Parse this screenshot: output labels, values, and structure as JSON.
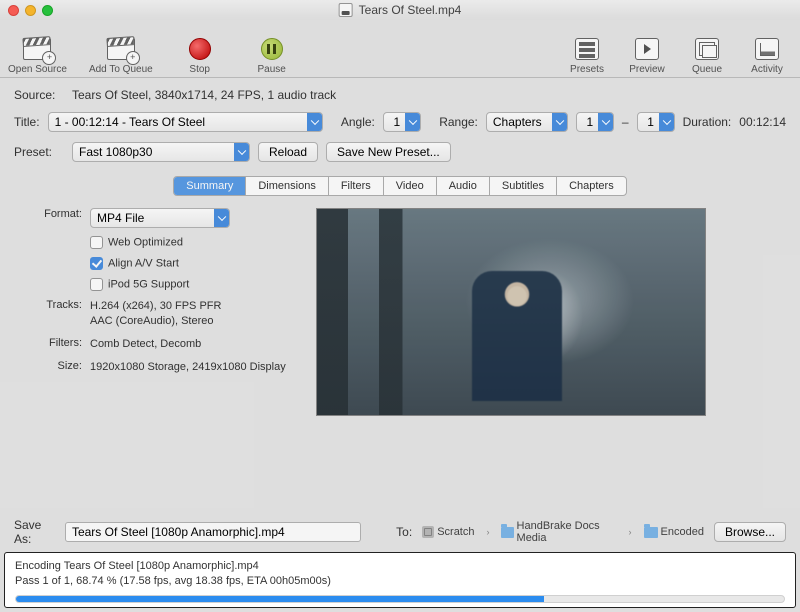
{
  "window": {
    "filename": "Tears Of Steel.mp4"
  },
  "toolbar": {
    "left": {
      "open_source": "Open Source",
      "add_to_queue": "Add To Queue",
      "stop": "Stop",
      "pause": "Pause"
    },
    "right": {
      "presets": "Presets",
      "preview": "Preview",
      "queue": "Queue",
      "activity": "Activity"
    }
  },
  "source": {
    "label": "Source:",
    "value": "Tears Of Steel, 3840x1714, 24 FPS, 1 audio track"
  },
  "title_row": {
    "label": "Title:",
    "value": "1 - 00:12:14 - Tears Of Steel",
    "angle_label": "Angle:",
    "angle_value": "1",
    "range_label": "Range:",
    "range_type": "Chapters",
    "range_from": "1",
    "range_to": "1",
    "range_sep": "–",
    "duration_label": "Duration:",
    "duration_value": "00:12:14"
  },
  "preset_row": {
    "label": "Preset:",
    "value": "Fast 1080p30",
    "reload": "Reload",
    "save_new": "Save New Preset..."
  },
  "tabs": [
    "Summary",
    "Dimensions",
    "Filters",
    "Video",
    "Audio",
    "Subtitles",
    "Chapters"
  ],
  "summary": {
    "format_label": "Format:",
    "format_value": "MP4 File",
    "web_optimized": "Web Optimized",
    "align_av": "Align A/V Start",
    "ipod": "iPod 5G Support",
    "tracks_label": "Tracks:",
    "tracks_value": "H.264 (x264), 30 FPS PFR\nAAC (CoreAudio), Stereo",
    "filters_label": "Filters:",
    "filters_value": "Comb Detect, Decomb",
    "size_label": "Size:",
    "size_value": "1920x1080 Storage, 2419x1080 Display"
  },
  "saveas": {
    "label": "Save As:",
    "filename": "Tears Of Steel [1080p Anamorphic].mp4",
    "to_label": "To:",
    "path": [
      "Scratch",
      "HandBrake Docs Media",
      "Encoded"
    ],
    "browse": "Browse..."
  },
  "progress": {
    "line1": "Encoding Tears Of Steel [1080p Anamorphic].mp4",
    "line2": "Pass 1 of 1, 68.74 % (17.58 fps, avg 18.38 fps, ETA 00h05m00s)",
    "percent": 68.74
  }
}
